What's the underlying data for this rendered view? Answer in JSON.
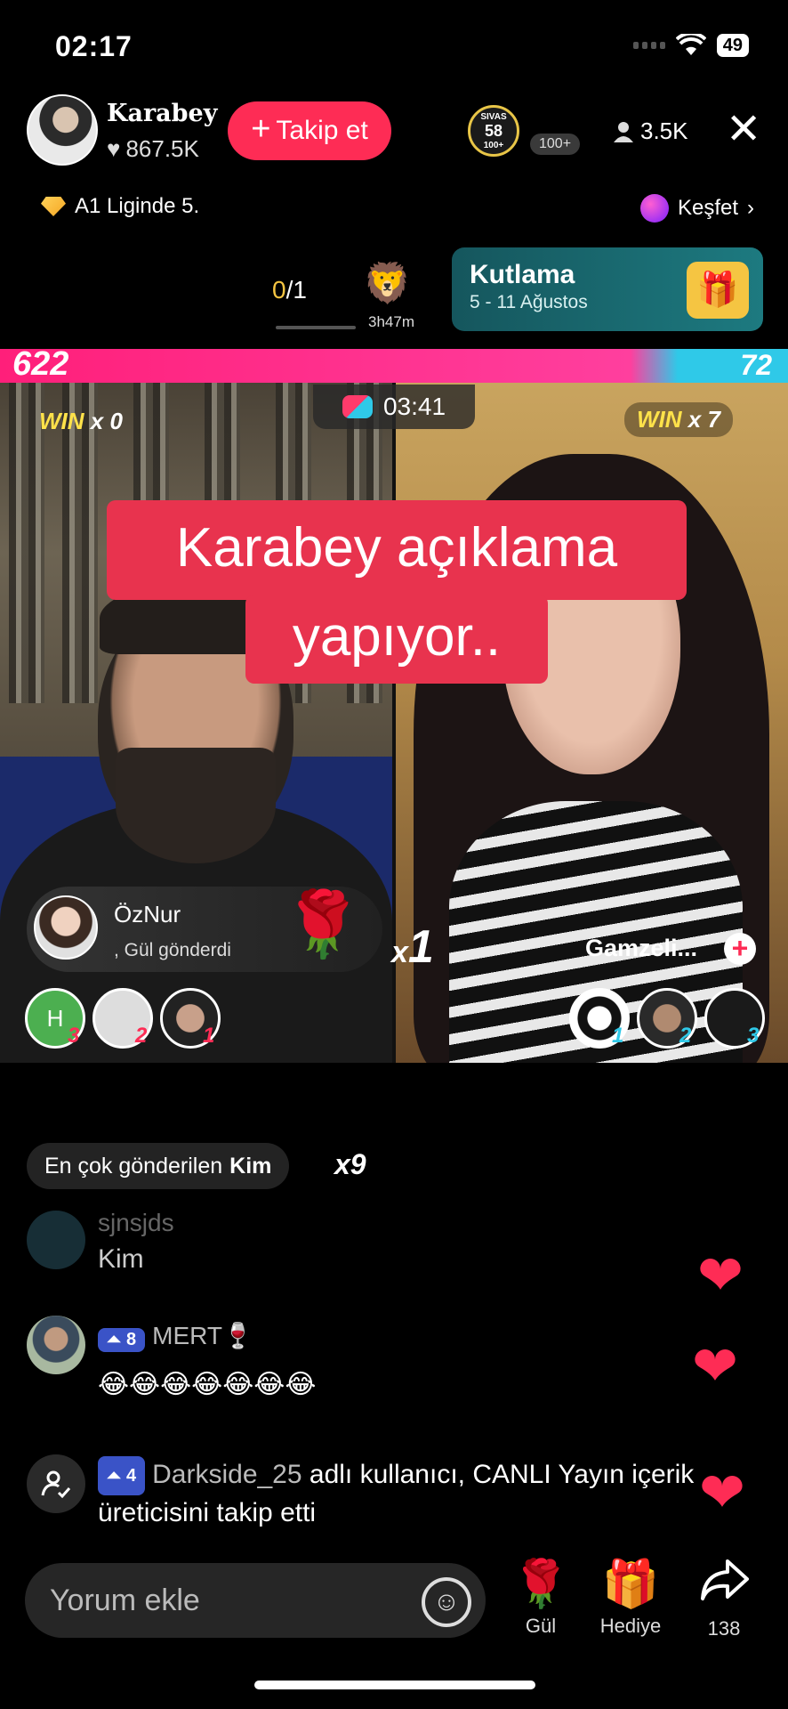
{
  "status": {
    "time": "02:17",
    "battery": "49"
  },
  "host": {
    "name": "Karabey",
    "likes": "867.5K",
    "follow_label": "Takip et"
  },
  "badges": {
    "sivas_top": "SIVAS",
    "sivas_num": "58",
    "sivas_bottom": "100+",
    "count_chip": "100+"
  },
  "viewers": "3.5K",
  "league": "A1 Liginde 5.",
  "explore": "Keşfet",
  "quest": {
    "done": "0",
    "total": "/1",
    "time": "3h47m"
  },
  "event": {
    "title": "Kutlama",
    "subtitle": "5 - 11 Ağustos"
  },
  "battle": {
    "score_left": "622",
    "score_right": "72",
    "timer": "03:41",
    "win_left_word": "WIN",
    "win_left_count": "x 0",
    "win_right_word": "WIN",
    "win_right_count": "x 7",
    "progress_left": 0.896
  },
  "caption": {
    "line1": "Karabey açıklama",
    "line2": "yapıyor.."
  },
  "gift_notice": {
    "user": "ÖzNur",
    "message": ", Gül  gönderdi",
    "combo_prefix": "x",
    "combo": "1"
  },
  "opponent": {
    "name": "Gamzeli..."
  },
  "left_ranks": [
    {
      "letter": "H",
      "rank": "3"
    },
    {
      "letter": "",
      "rank": "2"
    },
    {
      "letter": "",
      "rank": "1"
    }
  ],
  "right_ranks": [
    {
      "rank": "1"
    },
    {
      "rank": "2"
    },
    {
      "rank": "3"
    }
  ],
  "most_sent": {
    "label": "En çok gönderilen",
    "user": "Kim",
    "count": "x9"
  },
  "comments": [
    {
      "user": "sjnsjds",
      "text": "Kim"
    },
    {
      "user": "MERT",
      "level": "8",
      "user_emoji": "🍷",
      "text": "😂😂😂😂😂😂😂"
    },
    {
      "user": "Darkside_25",
      "level": "4",
      "text": " adlı kullanıcı, CANLI Yayın içerik üreticisini takip etti"
    }
  ],
  "bottom": {
    "comment_placeholder": "Yorum ekle",
    "rose_label": "Gül",
    "gift_label": "Hediye",
    "share_label": "138"
  }
}
